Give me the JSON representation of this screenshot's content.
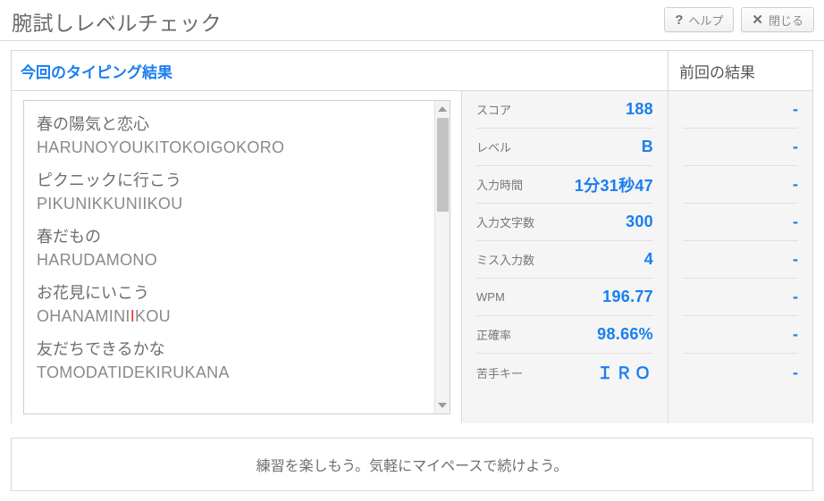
{
  "titlebar": {
    "title": "腕試しレベルチェック",
    "buttons": [
      {
        "name": "help",
        "glyph": "?",
        "label": "ヘルプ"
      },
      {
        "name": "close",
        "glyph": "✕",
        "label": "閉じる"
      }
    ]
  },
  "panel": {
    "current_header": "今回のタイピング結果",
    "previous_header": "前回の結果"
  },
  "typed_text": {
    "phrases": [
      {
        "jp": "春の陽気と恋心",
        "romaji_before": "HARUNOYOUKITOKOIGOKORO",
        "romaji_error": "",
        "romaji_after": ""
      },
      {
        "jp": "ピクニックに行こう",
        "romaji_before": "PIKUNIKKUNIIKOU",
        "romaji_error": "",
        "romaji_after": ""
      },
      {
        "jp": "春だもの",
        "romaji_before": "HARUDAMONO",
        "romaji_error": "",
        "romaji_after": ""
      },
      {
        "jp": "お花見にいこう",
        "romaji_before": "OHANAMINI",
        "romaji_error": "I",
        "romaji_after": "KOU"
      },
      {
        "jp": "友だちできるかな",
        "romaji_before": "TOMODATIDEKIRUKANA",
        "romaji_error": "",
        "romaji_after": ""
      }
    ]
  },
  "stats": {
    "rows": [
      {
        "label": "スコア",
        "value": "188",
        "prev": "-",
        "spaced": false
      },
      {
        "label": "レベル",
        "value": "B",
        "prev": "-",
        "spaced": false
      },
      {
        "label": "入力時間",
        "value": "1分31秒47",
        "prev": "-",
        "spaced": false
      },
      {
        "label": "入力文字数",
        "value": "300",
        "prev": "-",
        "spaced": false
      },
      {
        "label": "ミス入力数",
        "value": "4",
        "prev": "-",
        "spaced": false
      },
      {
        "label": "WPM",
        "value": "196.77",
        "prev": "-",
        "spaced": false
      },
      {
        "label": "正確率",
        "value": "98.66%",
        "prev": "-",
        "spaced": false
      },
      {
        "label": "苦手キー",
        "value": "ＩＲＯ",
        "prev": "-",
        "spaced": true
      }
    ]
  },
  "footer": {
    "message": "練習を楽しもう。気軽にマイペースで続けよう。"
  },
  "colors": {
    "accent_blue": "#1a7ef0",
    "error_red": "#e8302a",
    "panel_bg": "#f5f5f5",
    "border": "#d8d8d8"
  }
}
